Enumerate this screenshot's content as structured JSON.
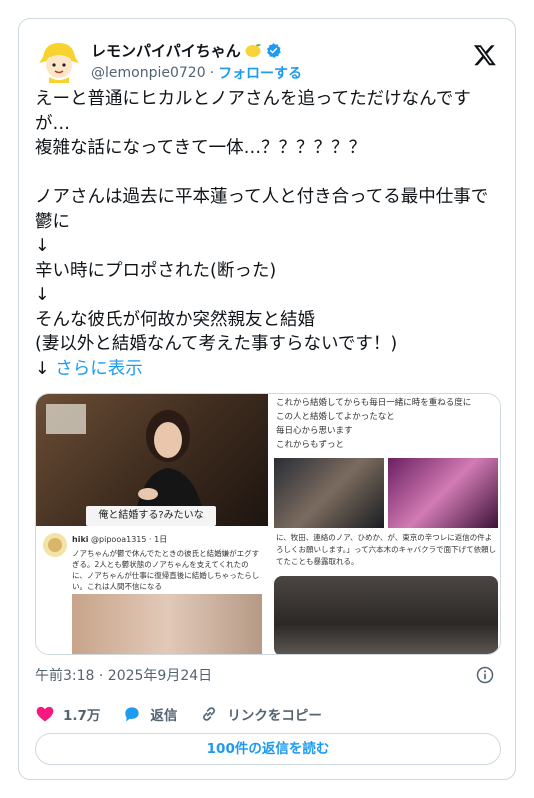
{
  "author": {
    "display_name": "レモンパイパイちゃん",
    "handle": "@lemonpie0720",
    "separator": "·",
    "follow_label": "フォローする"
  },
  "tweet": {
    "text": "えーと普通にヒカルとノアさんを追ってただけなんですが…\n複雑な話になってきて一体…？？？？？？\n\nノアさんは過去に平本蓮って人と付き合ってる最中仕事で鬱に\n↓\n辛い時にプロポされた(断った)\n↓\nそんな彼氏が何故か突然親友と結婚\n(妻以外と結婚なんて考えた事すらないです！)\n↓ ",
    "show_more": "さらに表示",
    "timestamp": "午前3:18 · 2025年9月24日"
  },
  "media": {
    "caption": "俺と結婚する?みたいな",
    "sub_tweet_name": "hiki",
    "sub_tweet_handle": "@pipooa1315 · 1日",
    "sub_tweet_text": "ノアちゃんが鬱で休んでたときの彼氏と結婚嫌がエグすぎる。2人とも鬱状態のノアちゃんを支えてくれたのに、ノアちゃんが仕事に復帰直後に結婚しちゃったらしい。これは人間不信になる",
    "right_text": "これから結婚してからも毎日一緒に時を重ねる度に\nこの人と結婚してよかったなと\n毎日心から思います\nこれからもずっと",
    "right_text2": "に、牧田、連絡のノア、ひめか、が、東京の辛つレに返信の件よろしくお願いします。」って六本木のキャバクラで面下げて依頼してたことも暴露取れる。"
  },
  "actions": {
    "likes": "1.7万",
    "reply_label": "返信",
    "copy_link_label": "リンクをコピー",
    "read_replies": "100件の返信を読む"
  },
  "colors": {
    "accent": "#1d9bf0",
    "like_pink": "#f91880",
    "text": "#0f1419",
    "muted": "#536471",
    "border": "#cfd9de"
  },
  "icons": [
    "avatar",
    "lemon-emoji",
    "verified-icon",
    "x-logo-icon",
    "info-icon",
    "heart-icon",
    "reply-icon",
    "link-icon"
  ]
}
